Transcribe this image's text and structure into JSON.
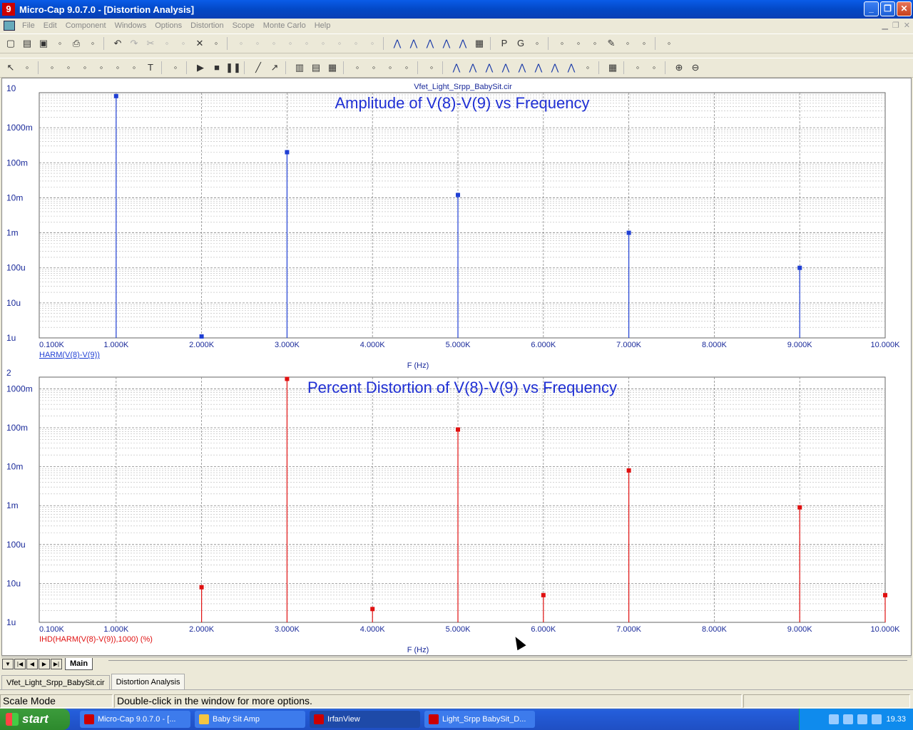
{
  "window": {
    "title": "Micro-Cap 9.0.7.0 - [Distortion Analysis]",
    "app_icon": "9",
    "minimize": "_",
    "restore": "❐",
    "close": "✕"
  },
  "menu": [
    "File",
    "Edit",
    "Component",
    "Windows",
    "Options",
    "Distortion",
    "Scope",
    "Monte Carlo",
    "Help"
  ],
  "toolbar1": [
    "new-icon",
    "open-icon",
    "save-icon",
    "save-all-icon",
    "print-icon",
    "preview-icon",
    "|",
    "undo-icon",
    "redo-icon",
    "cut-icon",
    "copy-icon",
    "paste-icon",
    "delete-icon",
    "text-icon",
    "|",
    "wire-icon",
    "resistor-icon",
    "capacitor-icon",
    "inductor-icon",
    "diode-icon",
    "transistor-icon",
    "opamp-icon",
    "source-icon",
    "ground-icon",
    "|",
    "tile-h-icon",
    "tile-v-icon",
    "cascade-icon",
    "window-icon",
    "window2-icon",
    "calc-icon",
    "|",
    "p-icon",
    "g-icon",
    "grid-icon",
    "|",
    "props-icon",
    "wave-icon",
    "probe-icon",
    "pen-icon",
    "analysis-icon",
    "vf-icon",
    "|",
    "export-icon"
  ],
  "toolbar2": [
    "select-icon",
    "grid-select-icon",
    "|",
    "scale-icon",
    "fft-icon",
    "bandwidth-icon",
    "step-icon",
    "poly-icon",
    "graph-icon",
    "text-tool-icon",
    "|",
    "tag-icon",
    "|",
    "run-icon",
    "stop-icon",
    "pause-icon",
    "|",
    "line-icon",
    "arrow-icon",
    "|",
    "grid1-icon",
    "grid2-icon",
    "grid3-icon",
    "|",
    "peak-icon",
    "valley-icon",
    "high-icon",
    "low-icon",
    "|",
    "chart-icon",
    "|",
    "cursor1-icon",
    "cursor2-icon",
    "peak-find-icon",
    "valley-find-icon",
    "slope-icon",
    "inflection-icon",
    "max-icon",
    "min-icon",
    "globe-icon",
    "|",
    "table-icon",
    "|",
    "tag-left-icon",
    "tag-right-icon",
    "|",
    "zoom-in-icon",
    "zoom-out-icon"
  ],
  "circuit_title": "Vfet_Light_Srpp_BabySit.cir",
  "chart_data": [
    {
      "type": "bar",
      "title": "Amplitude of V(8)-V(9) vs Frequency",
      "xlabel": "F (Hz)",
      "ylabel": "HARM(V(8)-V(9))",
      "yscale": "log",
      "ylim": [
        1e-06,
        10
      ],
      "xlim": [
        100,
        10000
      ],
      "x_ticks": [
        "0.100K",
        "1.000K",
        "2.000K",
        "3.000K",
        "4.000K",
        "5.000K",
        "6.000K",
        "7.000K",
        "8.000K",
        "9.000K",
        "10.000K"
      ],
      "x_tick_values": [
        100,
        1000,
        2000,
        3000,
        4000,
        5000,
        6000,
        7000,
        8000,
        9000,
        10000
      ],
      "y_ticks": [
        "1u",
        "10u",
        "100u",
        "1m",
        "10m",
        "100m",
        "1000m",
        "10"
      ],
      "y_tick_values": [
        1e-06,
        1e-05,
        0.0001,
        0.001,
        0.01,
        0.1,
        1,
        10
      ],
      "x": [
        1000,
        2000,
        3000,
        5000,
        7000,
        9000
      ],
      "values": [
        8,
        1.1e-06,
        0.2,
        0.012,
        0.001,
        0.0001
      ],
      "color": "#1f3fd4"
    },
    {
      "type": "bar",
      "title": "Percent Distortion of V(8)-V(9) vs Frequency",
      "xlabel": "F (Hz)",
      "ylabel": "IHD(HARM(V(8)-V(9)),1000) (%)",
      "yscale": "log",
      "ylim": [
        1e-06,
        2
      ],
      "xlim": [
        100,
        10000
      ],
      "x_ticks": [
        "0.100K",
        "1.000K",
        "2.000K",
        "3.000K",
        "4.000K",
        "5.000K",
        "6.000K",
        "7.000K",
        "8.000K",
        "9.000K",
        "10.000K"
      ],
      "x_tick_values": [
        100,
        1000,
        2000,
        3000,
        4000,
        5000,
        6000,
        7000,
        8000,
        9000,
        10000
      ],
      "y_ticks": [
        "1u",
        "10u",
        "100u",
        "1m",
        "10m",
        "100m",
        "1000m",
        "2"
      ],
      "y_tick_values": [
        1e-06,
        1e-05,
        0.0001,
        0.001,
        0.01,
        0.1,
        1,
        2
      ],
      "x": [
        2000,
        3000,
        4000,
        5000,
        6000,
        7000,
        9000,
        10000
      ],
      "values": [
        8e-06,
        1.8,
        2.2e-06,
        0.09,
        5e-06,
        0.008,
        0.0009,
        5e-06
      ],
      "color": "#e01010"
    }
  ],
  "tabs": {
    "nav": [
      "▼",
      "|◀",
      "◀",
      "▶",
      "▶|"
    ],
    "main": "Main"
  },
  "doc_tabs": [
    "Vfet_Light_Srpp_BabySit.cir",
    "Distortion Analysis"
  ],
  "status": {
    "mode": "Scale Mode",
    "message": "Double-click in the window for more options."
  },
  "taskbar": {
    "start": "start",
    "items": [
      "Micro-Cap 9.0.7.0 - [...",
      "Baby Sit Amp",
      "IrfanView",
      "Light_Srpp BabySit_D..."
    ],
    "clock": "19.33"
  }
}
